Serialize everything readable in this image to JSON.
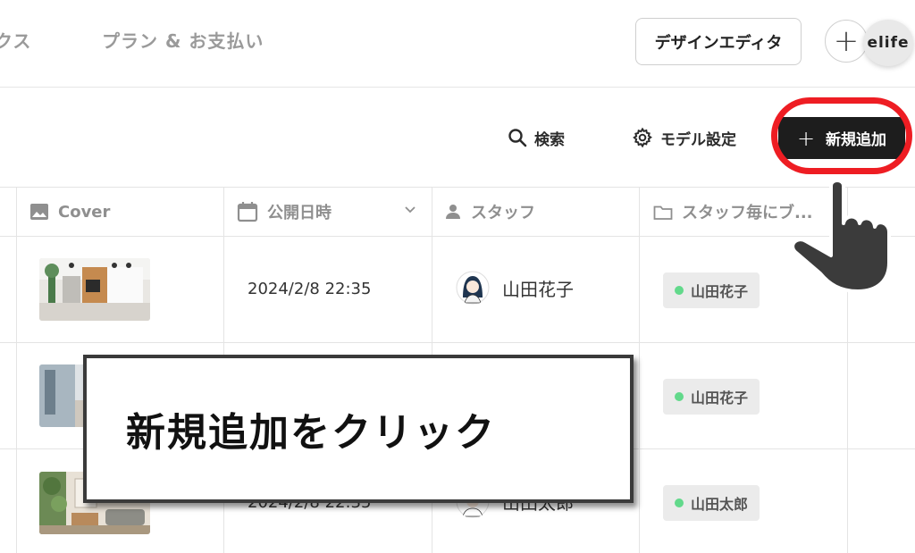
{
  "topnav": {
    "tab_partial": "クス",
    "tab_billing": "プラン & お支払い",
    "design_editor_label": "デザインエディタ",
    "add_icon": "plus-icon",
    "workspace_label": "elife"
  },
  "toolbar": {
    "search_label": "検索",
    "model_settings_label": "モデル設定",
    "new_button_label": "新規追加"
  },
  "table": {
    "columns": [
      {
        "label": "Cover",
        "icon": "image-icon"
      },
      {
        "label": "公開日時",
        "icon": "calendar-icon"
      },
      {
        "label": "スタッフ",
        "icon": "person-icon"
      },
      {
        "label": "スタッフ毎にブ...",
        "icon": "folder-icon"
      }
    ],
    "rows": [
      {
        "date": "2024/2/8 22:35",
        "staff": "山田花子",
        "tag": "山田花子"
      },
      {
        "date": "",
        "staff": "",
        "tag": "山田花子"
      },
      {
        "date": "2024/2/8 22:35",
        "staff": "山田太郎",
        "tag": "山田太郎"
      }
    ]
  },
  "annotation": {
    "callout_text": "新規追加をクリック",
    "highlight_color": "#ee1d23"
  }
}
